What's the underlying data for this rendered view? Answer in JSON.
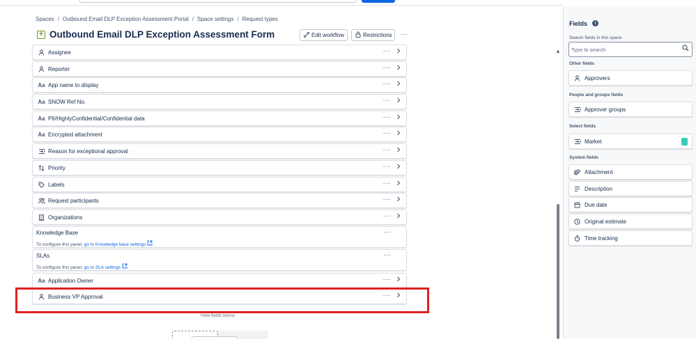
{
  "breadcrumb": [
    "Spaces",
    "Outbound Email DLP Exception Assessment Portal",
    "Space settings",
    "Request types"
  ],
  "page": {
    "title": "Outbound Email DLP Exception Assessment Form",
    "edit_workflow": "Edit workflow",
    "restrictions": "Restrictions",
    "more": "···"
  },
  "fields": [
    {
      "label": "Assignee",
      "icon": "person-icon"
    },
    {
      "label": "Reporter",
      "icon": "person-icon"
    },
    {
      "label": "App name to display",
      "icon": "text-field-icon"
    },
    {
      "label": "SNOW Ref No.",
      "icon": "text-field-icon"
    },
    {
      "label": "PII/HighlyConfidential/Confidential data",
      "icon": "text-field-icon"
    },
    {
      "label": "Encrypted attachment",
      "icon": "text-field-icon"
    },
    {
      "label": "Reason for exceptional approval",
      "icon": "select-list-icon"
    },
    {
      "label": "Priority",
      "icon": "priority-icon"
    },
    {
      "label": "Labels",
      "icon": "tag-icon"
    },
    {
      "label": "Request participants",
      "icon": "people-icon"
    },
    {
      "label": "Organizations",
      "icon": "building-icon"
    }
  ],
  "panels": [
    {
      "title": "Knowledge Base",
      "prefix": "To configure this panel, ",
      "link": "go to Knowledge base settings",
      "suffix": "."
    },
    {
      "title": "SLAs",
      "prefix": "To configure this panel, ",
      "link": "go to SLA settings",
      "suffix": "."
    }
  ],
  "fields_after": [
    {
      "label": "Application Owner",
      "icon": "text-field-icon"
    },
    {
      "label": "Business VP Approval",
      "icon": "person-icon"
    }
  ],
  "hide_fields_label": "Hide fields below",
  "text_icon_glyph": "Aa",
  "sidebar": {
    "title": "Fields",
    "search_label": "Search fields in this space",
    "search_placeholder": "Type to search",
    "groups": [
      {
        "name": "Other fields",
        "items": [
          {
            "label": "Approvers",
            "icon": "person-icon"
          }
        ]
      },
      {
        "name": "People and groups fields",
        "items": [
          {
            "label": "Approver groups",
            "icon": "select-list-icon"
          }
        ]
      },
      {
        "name": "Select fields",
        "items": [
          {
            "label": "Market",
            "icon": "select-list-icon",
            "badge": true
          }
        ]
      },
      {
        "name": "System fields",
        "items": [
          {
            "label": "Attachment",
            "icon": "paperclip-icon"
          },
          {
            "label": "Description",
            "icon": "paragraph-icon"
          },
          {
            "label": "Due date",
            "icon": "calendar-icon"
          },
          {
            "label": "Original estimate",
            "icon": "clock-icon"
          },
          {
            "label": "Time tracking",
            "icon": "stopwatch-icon"
          }
        ]
      }
    ]
  },
  "colors": {
    "highlight": "#e02020",
    "link": "#0c66e4",
    "badge": "#3cc9b4"
  }
}
